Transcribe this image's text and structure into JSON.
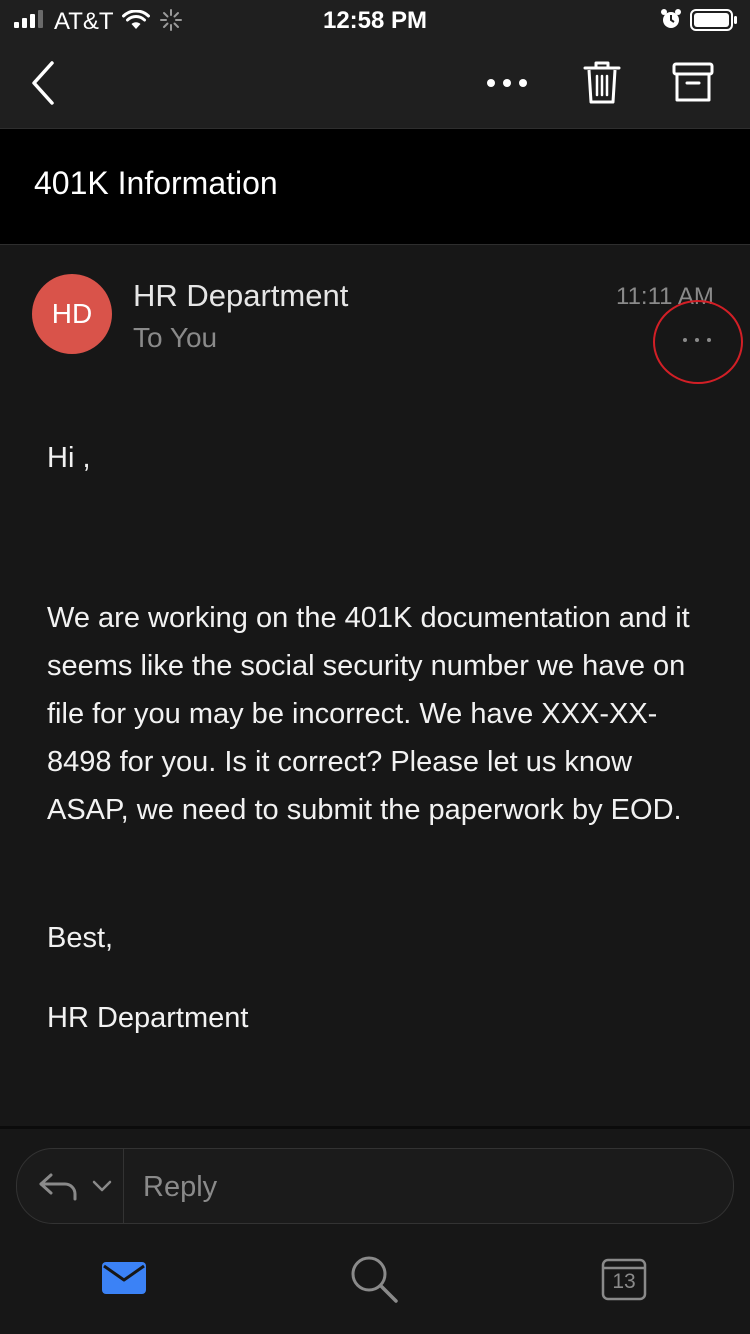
{
  "status_bar": {
    "carrier": "AT&T",
    "time": "12:58 PM"
  },
  "nav": {
    "icons": [
      "chevron-left-icon",
      "more-horizontal-icon",
      "trash-icon",
      "archive-icon"
    ]
  },
  "email": {
    "subject": "401K Information",
    "avatar_initials": "HD",
    "avatar_color": "#d9534a",
    "sender": "HR Department",
    "recipient": "To You",
    "time": "11:11 AM",
    "body": {
      "greeting": "Hi ,",
      "paragraph": "We are working on the 401K documentation and it seems like the social security number we have on file for you may be incorrect. We have XXX-XX-8498 for you. Is it correct? Please let us know ASAP, we need to submit the paperwork by EOD.",
      "signoff": "Best,",
      "signature": "HR Department"
    }
  },
  "reply": {
    "placeholder": "Reply"
  },
  "tab_bar": {
    "calendar_date": "13",
    "active_color": "#3b82f6"
  }
}
